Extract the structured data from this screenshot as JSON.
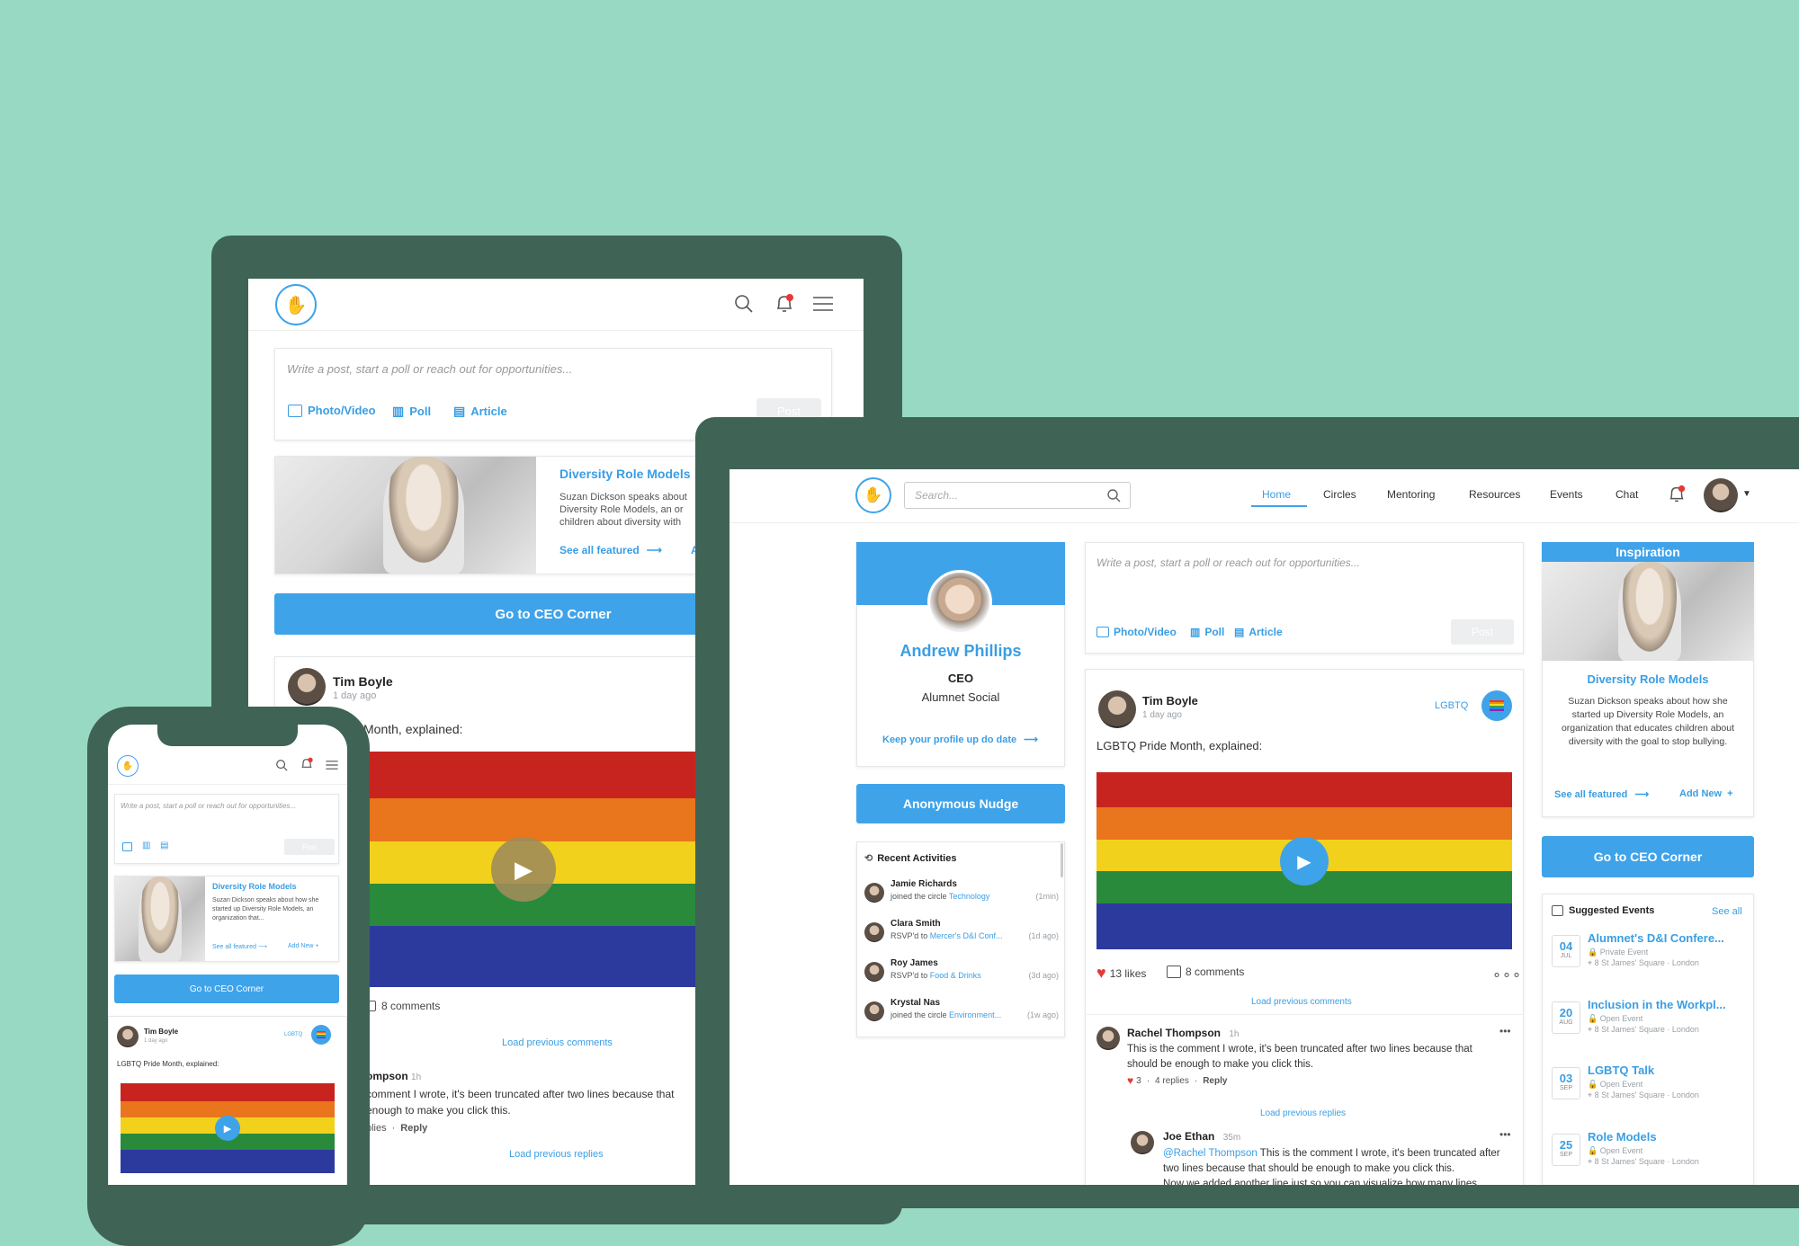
{
  "app": {
    "brand_color": "#3fa3ea",
    "background_color": "#98d9c4",
    "frame_color": "#3f6355"
  },
  "composer": {
    "placeholder": "Write a post, start a poll or reach out for opportunities...",
    "photo_video": "Photo/Video",
    "poll": "Poll",
    "article": "Article",
    "post": "Post"
  },
  "featured": {
    "title": "Diversity Role Models",
    "body": "Suzan Dickson speaks about how she started up Diversity Role Models, an organization that educates children about diversity with the goal to stop bullying.",
    "tablet_body": "Suzan Dickson speaks about Diversity Role Models, an or children about diversity with",
    "phone_body": "Suzan Dickson speaks about how she started up Diversity Role Models, an organization that...",
    "see_all": "See all featured",
    "add_new": "Add New",
    "tablet_add": "Ad"
  },
  "ceo_corner": "Go to CEO Corner",
  "post": {
    "author": "Tim Boyle",
    "time": "1 day ago",
    "tag": "LGBTQ",
    "text": "LGBTQ Pride Month, explained:",
    "tablet_text": "Month, explained:",
    "likes": "13 likes",
    "comments": "8 comments",
    "load_prev_comments": "Load previous comments",
    "load_prev_replies": "Load previous replies"
  },
  "comment": {
    "author": "Rachel Thompson",
    "tablet_author": "ompson",
    "time": "1h",
    "text": "This is the comment I wrote, it's been truncated after two lines because that should be enough to make you click this.",
    "tablet_line1": "comment I wrote, it's been truncated after two lines because that",
    "tablet_line2": "enough to make you click this.",
    "likes": "3",
    "replies": "4 replies",
    "tablet_replies": "plies",
    "reply": "Reply"
  },
  "reply": {
    "author": "Joe Ethan",
    "time": "35m",
    "mention": "@Rachel Thompson",
    "text": "This is the comment I wrote, it's been truncated after two lines because that should be enough to make you click this.",
    "line3": "Now we added another line just so you can visualize how many lines"
  },
  "desktop": {
    "search_placeholder": "Search...",
    "nav": [
      "Home",
      "Circles",
      "Mentoring",
      "Resources",
      "Events",
      "Chat"
    ]
  },
  "profile": {
    "name": "Andrew Phillips",
    "role": "CEO",
    "company": "Alumnet Social",
    "link": "Keep your profile up do date"
  },
  "nudge": "Anonymous Nudge",
  "recent": {
    "title": "Recent Activities",
    "items": [
      {
        "name": "Jamie Richards",
        "action": "joined the circle ",
        "target": "Technology",
        "time": "(1min)"
      },
      {
        "name": "Clara Smith",
        "action": "RSVP'd to ",
        "target": "Mercer's D&I Conf...",
        "time": "(1d ago)"
      },
      {
        "name": "Roy James",
        "action": "RSVP'd to ",
        "target": "Food & Drinks",
        "time": "(3d ago)"
      },
      {
        "name": "Krystal Nas",
        "action": "joined the circle ",
        "target": "Environment...",
        "time": "(1w ago)"
      }
    ]
  },
  "inspiration": {
    "title": "Inspiration"
  },
  "events": {
    "title": "Suggested Events",
    "see_all": "See all",
    "items": [
      {
        "day": "04",
        "month": "JUL",
        "title": "Alumnet's D&I Confere...",
        "type": "Private Event",
        "place": "8 St James' Square · London"
      },
      {
        "day": "20",
        "month": "AUG",
        "title": "Inclusion in the Workpl...",
        "type": "Open Event",
        "place": "8 St James' Square · London"
      },
      {
        "day": "03",
        "month": "SEP",
        "title": "LGBTQ Talk",
        "type": "Open Event",
        "place": "8 St James' Square · London"
      },
      {
        "day": "25",
        "month": "SEP",
        "title": "Role Models",
        "type": "Open Event",
        "place": "8 St James' Square · London"
      }
    ]
  }
}
